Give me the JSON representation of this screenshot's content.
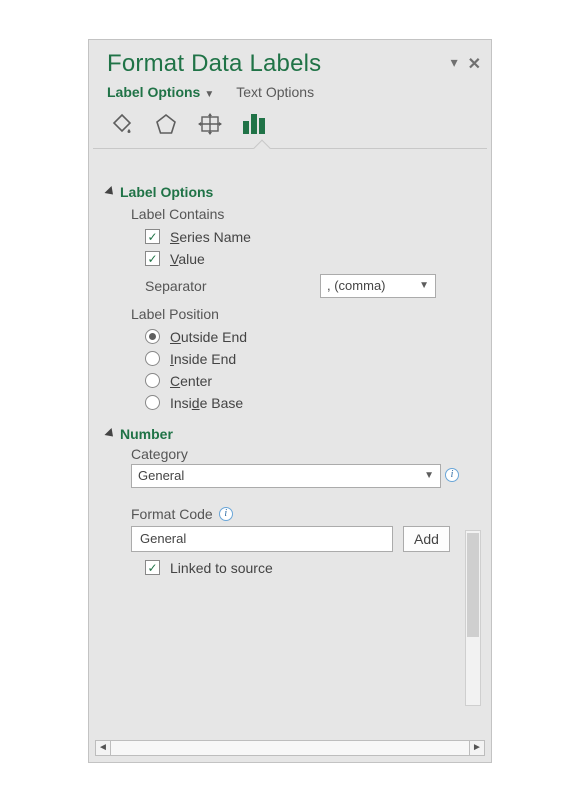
{
  "title": "Format Data Labels",
  "tabs": {
    "labelOptions": "Label Options",
    "textOptions": "Text Options"
  },
  "sections": {
    "labelOptions": {
      "header": "Label Options",
      "labelContains": "Label Contains",
      "seriesName": "Series Name",
      "value": "Value",
      "separatorLabel": "Separator",
      "separatorValue": ", (comma)",
      "labelPosition": "Label Position",
      "pos": {
        "outsideEnd": "Outside End",
        "insideEnd": "Inside End",
        "center": "Center",
        "insideBase": "Inside Base"
      }
    },
    "number": {
      "header": "Number",
      "categoryLabel": "Category",
      "categoryValue": "General",
      "formatCodeLabel": "Format Code",
      "formatCodeValue": "General",
      "addBtn": "Add",
      "linked": "Linked to source"
    }
  }
}
